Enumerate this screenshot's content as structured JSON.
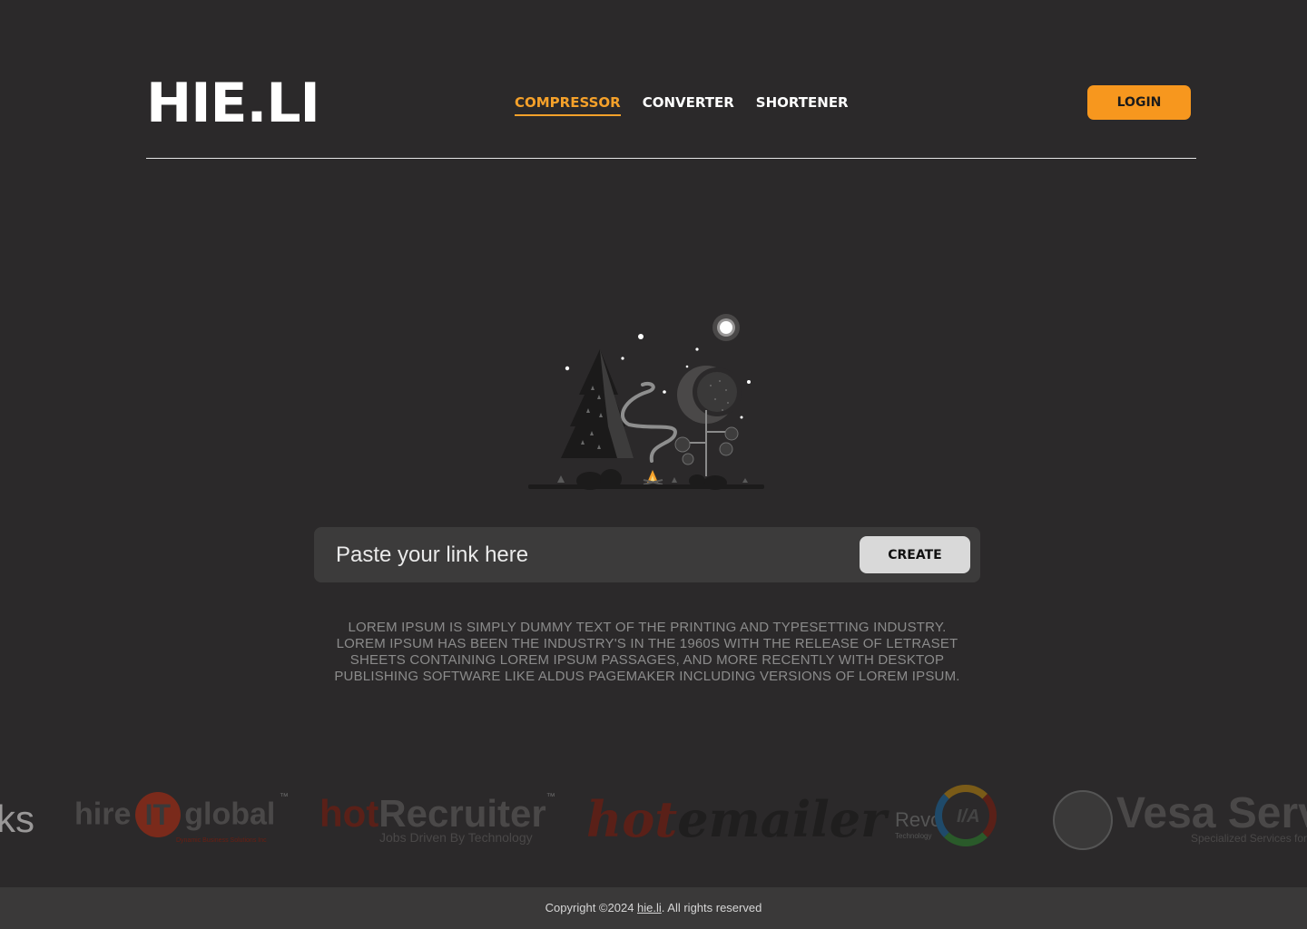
{
  "brand": {
    "logo_text": "HIE.LI"
  },
  "nav": {
    "items": [
      {
        "label": "COMPRESSOR",
        "active": true
      },
      {
        "label": "CONVERTER",
        "active": false
      },
      {
        "label": "SHORTENER",
        "active": false
      }
    ],
    "login_label": "LOGIN"
  },
  "form": {
    "placeholder": "Paste your link here",
    "create_label": "CREATE"
  },
  "description": "LOREM IPSUM IS SIMPLY DUMMY TEXT OF THE PRINTING AND TYPESETTING INDUSTRY. LOREM IPSUM HAS BEEN THE INDUSTRY'S IN THE 1960S WITH THE RELEASE OF LETRASET SHEETS CONTAINING LOREM IPSUM PASSAGES, AND MORE RECENTLY WITH DESKTOP PUBLISHING SOFTWARE LIKE ALDUS PAGEMAKER INCLUDING VERSIONS OF LOREM IPSUM.",
  "partners": {
    "first_partial": "ks",
    "hireit": {
      "pre": "hire",
      "mid": "IT",
      "post": "global",
      "tm": "™",
      "tagline": "Dynamic Business Solutions Inc"
    },
    "hotrecruiter": {
      "hot": "hot",
      "rest": "Recruiter",
      "tm": "™",
      "tagline": "Jobs Driven By Technology"
    },
    "hotemailer": {
      "hot": "hot",
      "rest": "emailer"
    },
    "revo": {
      "name": "Revo",
      "sub": "Technology",
      "badge": "I/A"
    },
    "vesa": {
      "name": "Vesa Serv",
      "tagline": "Specialized Services for"
    }
  },
  "footer": {
    "prefix": "Copyright ©2024 ",
    "link": "hie.li",
    "suffix": ". All rights reserved"
  },
  "colors": {
    "background": "#2b292a",
    "accent": "#f7971e",
    "active_nav": "#f5a12a",
    "input_bg": "#3c3b3b",
    "footer_bg": "#3a3939"
  },
  "icons": [
    "night-forest-illustration",
    "moon-icon",
    "campfire-icon"
  ]
}
